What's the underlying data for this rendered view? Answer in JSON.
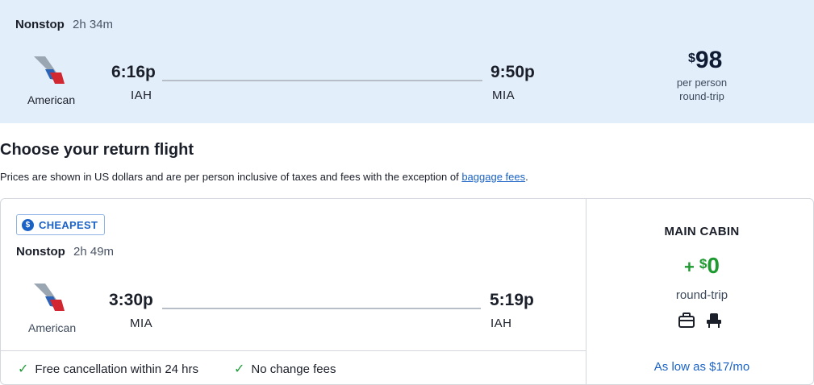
{
  "outbound": {
    "stops": "Nonstop",
    "duration": "2h 34m",
    "airline": "American",
    "depart_time": "6:16p",
    "depart_code": "IAH",
    "arrive_time": "9:50p",
    "arrive_code": "MIA",
    "price_currency": "$",
    "price_amount": "98",
    "price_line1": "per person",
    "price_line2": "round-trip"
  },
  "section": {
    "heading": "Choose your return flight",
    "note_prefix": "Prices are shown in US dollars and are per person inclusive of taxes and fees with the exception of ",
    "note_link": "baggage fees",
    "note_suffix": "."
  },
  "return_flight": {
    "badge": "CHEAPEST",
    "stops": "Nonstop",
    "duration": "2h 49m",
    "airline": "American",
    "depart_time": "3:30p",
    "depart_code": "MIA",
    "arrive_time": "5:19p",
    "arrive_code": "IAH",
    "features": [
      "Free cancellation within 24 hrs",
      "No change fees"
    ],
    "cabin": {
      "title": "MAIN CABIN",
      "plus": "+",
      "currency": "$",
      "amount": "0",
      "sub": "round-trip",
      "icons": [
        "carry-on-bag-icon",
        "seat-icon"
      ],
      "financing": "As low as $17/mo"
    }
  },
  "colors": {
    "band_bg": "#e3eefb",
    "accent_blue": "#1a62c6",
    "price_green": "#1e9a31",
    "check_green": "#1f9d3a"
  }
}
